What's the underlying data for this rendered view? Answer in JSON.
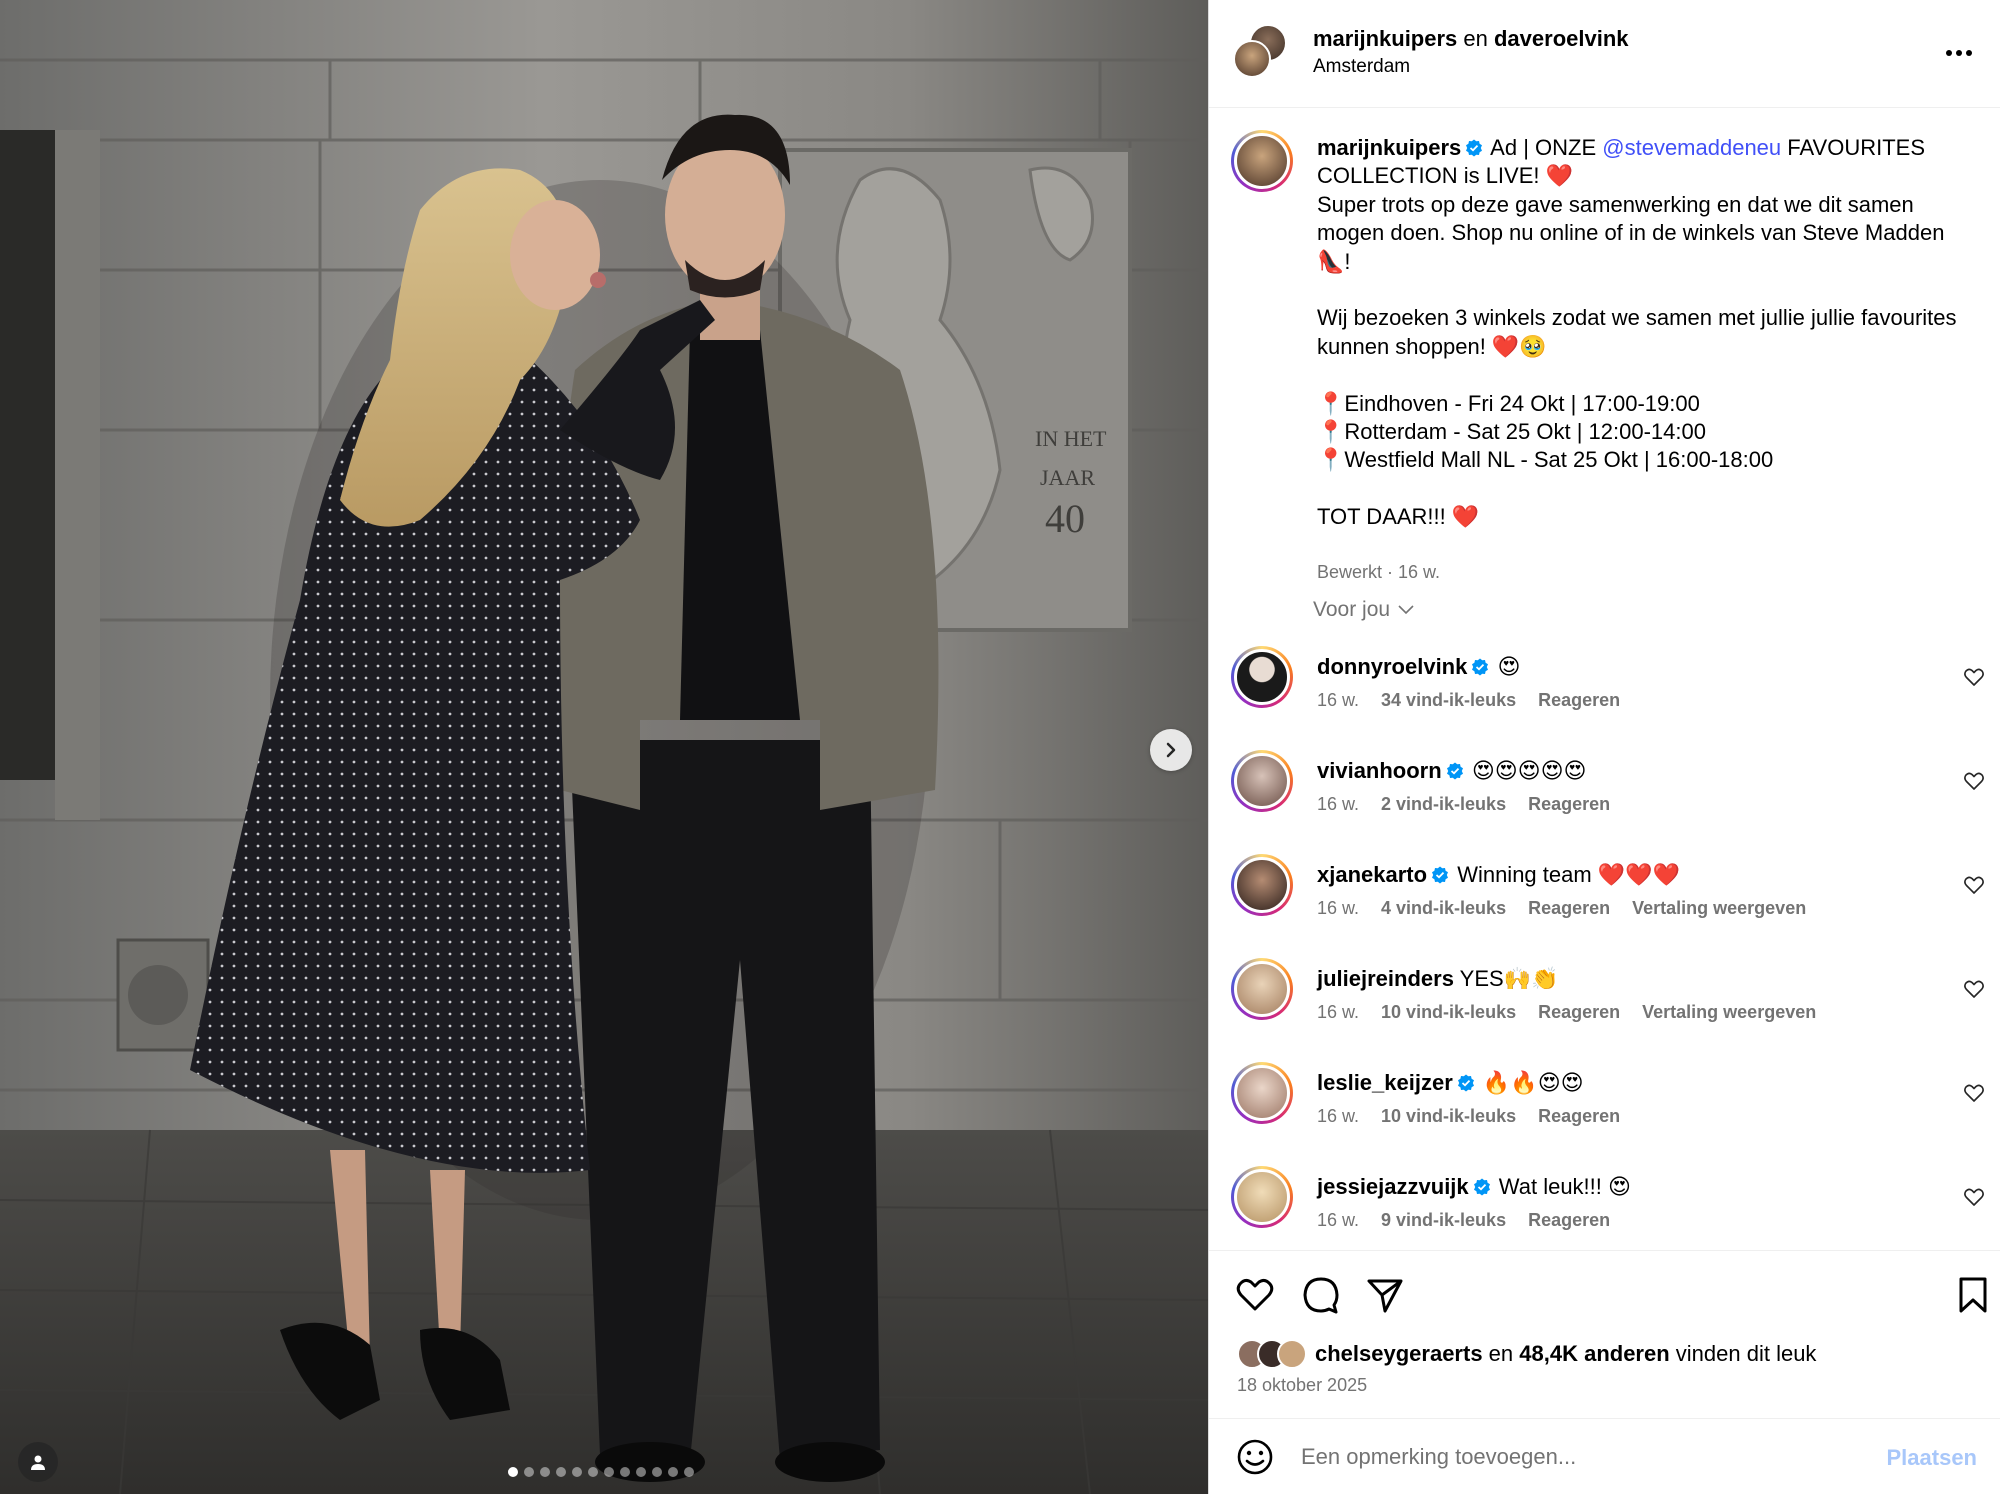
{
  "post": {
    "header": {
      "author1": "marijnkuipers",
      "connector": " en ",
      "author2": "daveroelvink",
      "location": "Amsterdam"
    },
    "caption": {
      "username": "marijnkuipers",
      "text_before_mention": " Ad | ONZE ",
      "mention": "@stevemaddeneu",
      "text_after_mention": " FAVOURITES COLLECTION is LIVE! ❤️\nSuper trots op deze gave samenwerking en dat we dit samen mogen doen. Shop nu online of in de winkels van Steve Madden 👠!\n\nWij bezoeken 3 winkels zodat we samen met jullie jullie favourites kunnen shoppen! ❤️🥹\n\n📍Eindhoven - Fri 24 Okt | 17:00-19:00\n📍Rotterdam - Sat 25 Okt | 12:00-14:00\n📍Westfield Mall NL - Sat 25 Okt | 16:00-18:00\n\nTOT DAAR!!! ❤️",
      "meta": "Bewerkt · 16 w."
    },
    "for_you_label": "Voor jou",
    "comments": [
      {
        "username": "donnyroelvink",
        "verified": true,
        "text": "😍",
        "age": "16 w.",
        "likes": "34 vind-ik-leuks",
        "reply": "Reageren",
        "translate": ""
      },
      {
        "username": "vivianhoorn",
        "verified": true,
        "text": "😍😍😍😍😍",
        "age": "16 w.",
        "likes": "2 vind-ik-leuks",
        "reply": "Reageren",
        "translate": ""
      },
      {
        "username": "xjanekarto",
        "verified": true,
        "text": "Winning team ❤️❤️❤️",
        "age": "16 w.",
        "likes": "4 vind-ik-leuks",
        "reply": "Reageren",
        "translate": "Vertaling weergeven"
      },
      {
        "username": "juliejreinders",
        "verified": false,
        "text": "YES🙌👏",
        "age": "16 w.",
        "likes": "10 vind-ik-leuks",
        "reply": "Reageren",
        "translate": "Vertaling weergeven"
      },
      {
        "username": "leslie_keijzer",
        "verified": true,
        "text": "🔥🔥😍😍",
        "age": "16 w.",
        "likes": "10 vind-ik-leuks",
        "reply": "Reageren",
        "translate": ""
      },
      {
        "username": "jessiejazzvuijk",
        "verified": true,
        "text": "Wat leuk!!! 😍",
        "age": "16 w.",
        "likes": "9 vind-ik-leuks",
        "reply": "Reageren",
        "translate": ""
      }
    ],
    "likes": {
      "first_user": "chelseygeraerts",
      "connector": " en ",
      "others": "48,4K anderen",
      "suffix": " vinden dit leuk"
    },
    "date": "18 oktober 2025",
    "comment_input": {
      "placeholder": "Een opmerking toevoegen...",
      "post_label": "Plaatsen"
    },
    "photo": {
      "wall_text_line1": "IN HET",
      "wall_text_line2": "JAAR",
      "wall_text_line3": "40",
      "carousel_active_index": 1,
      "carousel_count": 12
    },
    "colors": {
      "mention": "#4150f7",
      "verified": "#0095f6",
      "secondary_text": "#737373",
      "post_button_disabled": "#a8c7fa"
    },
    "icons": [
      "more-icon",
      "verified-icon",
      "chevron-down-icon",
      "heart-icon",
      "comment-icon",
      "share-icon",
      "bookmark-icon",
      "emoji-icon",
      "next-arrow-icon",
      "user-tag-icon"
    ]
  }
}
